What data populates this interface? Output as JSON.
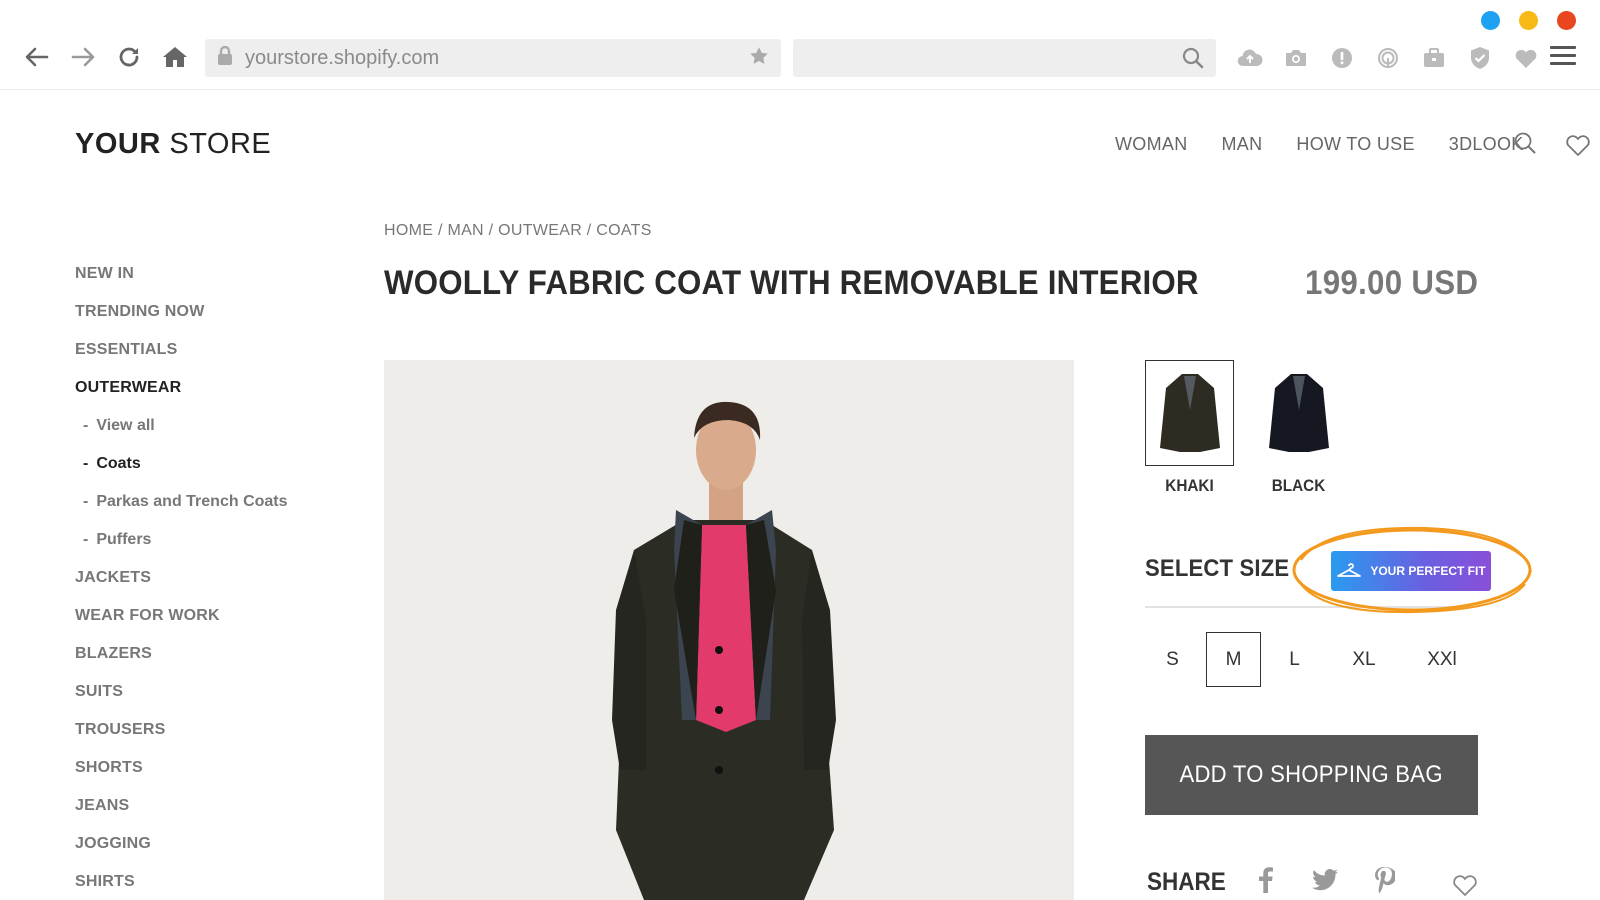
{
  "browser": {
    "url": "yourstore.shopify.com",
    "window_dots": [
      "#1ea1f2",
      "#f7b916",
      "#e8461e"
    ],
    "nav_icons": [
      "back-arrow-icon",
      "forward-arrow-icon",
      "reload-icon",
      "home-icon"
    ],
    "extension_icons": [
      "cloud-upload-icon",
      "camera-icon",
      "alert-icon",
      "fingerprint-icon",
      "briefcase-icon",
      "shield-icon",
      "heart-icon"
    ]
  },
  "store": {
    "logo_bold": "YOUR",
    "logo_light": " STORE",
    "nav": [
      "WOMAN",
      "MAN",
      "HOW TO USE",
      "3DLOOK"
    ]
  },
  "sidebar": {
    "items": [
      {
        "label": "NEW IN"
      },
      {
        "label": "TRENDING NOW"
      },
      {
        "label": "ESSENTIALS"
      },
      {
        "label": "OUTERWEAR",
        "active": true
      },
      {
        "label": "View all",
        "sub": true
      },
      {
        "label": "Coats",
        "sub": true,
        "active": true
      },
      {
        "label": "Parkas and Trench Coats",
        "sub": true
      },
      {
        "label": "Puffers",
        "sub": true
      },
      {
        "label": "JACKETS"
      },
      {
        "label": "WEAR FOR WORK"
      },
      {
        "label": "BLAZERS"
      },
      {
        "label": "SUITS"
      },
      {
        "label": "TROUSERS"
      },
      {
        "label": "SHORTS"
      },
      {
        "label": "JEANS"
      },
      {
        "label": "JOGGING"
      },
      {
        "label": "SHIRTS"
      }
    ]
  },
  "product": {
    "breadcrumb": [
      "HOME",
      "MAN",
      "OUTWEAR",
      "COATS"
    ],
    "breadcrumb_sep": " / ",
    "title": "WOOLLY FABRIC COAT WITH REMOVABLE INTERIOR",
    "price": "199.00 USD",
    "colors": [
      {
        "label": "KHAKI",
        "hex": "#2e2c22",
        "selected": true
      },
      {
        "label": "BLACK",
        "hex": "#151820",
        "selected": false
      }
    ],
    "select_size_label": "SELECT SIZE",
    "perfect_fit_label": "YOUR PERFECT FIT",
    "sizes": [
      {
        "label": "S",
        "selected": false
      },
      {
        "label": "M",
        "selected": true
      },
      {
        "label": "L",
        "selected": false
      },
      {
        "label": "XL",
        "selected": false
      },
      {
        "label": "XXl",
        "selected": false
      }
    ],
    "add_to_bag_label": "ADD TO SHOPPING BAG",
    "share_label": "SHARE",
    "share_icons": [
      "facebook-icon",
      "twitter-icon",
      "pinterest-icon"
    ]
  },
  "colors": {
    "accent_gradient_start": "#2a9bf0",
    "accent_gradient_end": "#8a4fd8",
    "highlight_ring": "#f39a1e",
    "button_dark": "#565656"
  }
}
